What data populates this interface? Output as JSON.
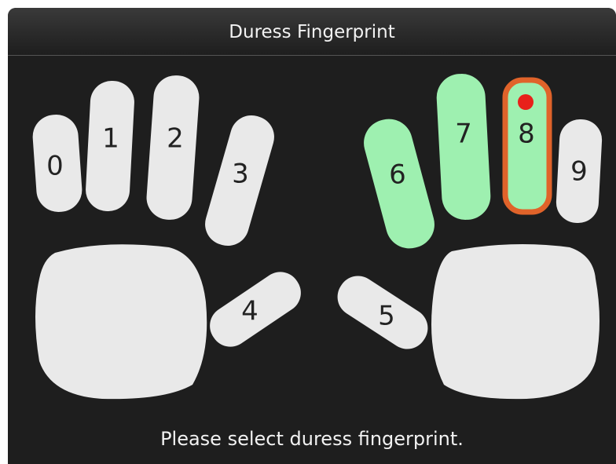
{
  "window": {
    "title": "Duress Fingerprint"
  },
  "fingers": [
    {
      "label": "0",
      "state": "unregistered"
    },
    {
      "label": "1",
      "state": "unregistered"
    },
    {
      "label": "2",
      "state": "unregistered"
    },
    {
      "label": "3",
      "state": "unregistered"
    },
    {
      "label": "4",
      "state": "unregistered"
    },
    {
      "label": "5",
      "state": "unregistered"
    },
    {
      "label": "6",
      "state": "registered"
    },
    {
      "label": "7",
      "state": "registered"
    },
    {
      "label": "8",
      "state": "selected"
    },
    {
      "label": "9",
      "state": "unregistered"
    }
  ],
  "prompt": "Please select duress fingerprint.",
  "colors": {
    "unregistered": "#e9e9e9",
    "registered": "#9ef0b0",
    "selected_border": "#e0632a",
    "marker": "#e8201a",
    "background": "#1e1e1e"
  }
}
